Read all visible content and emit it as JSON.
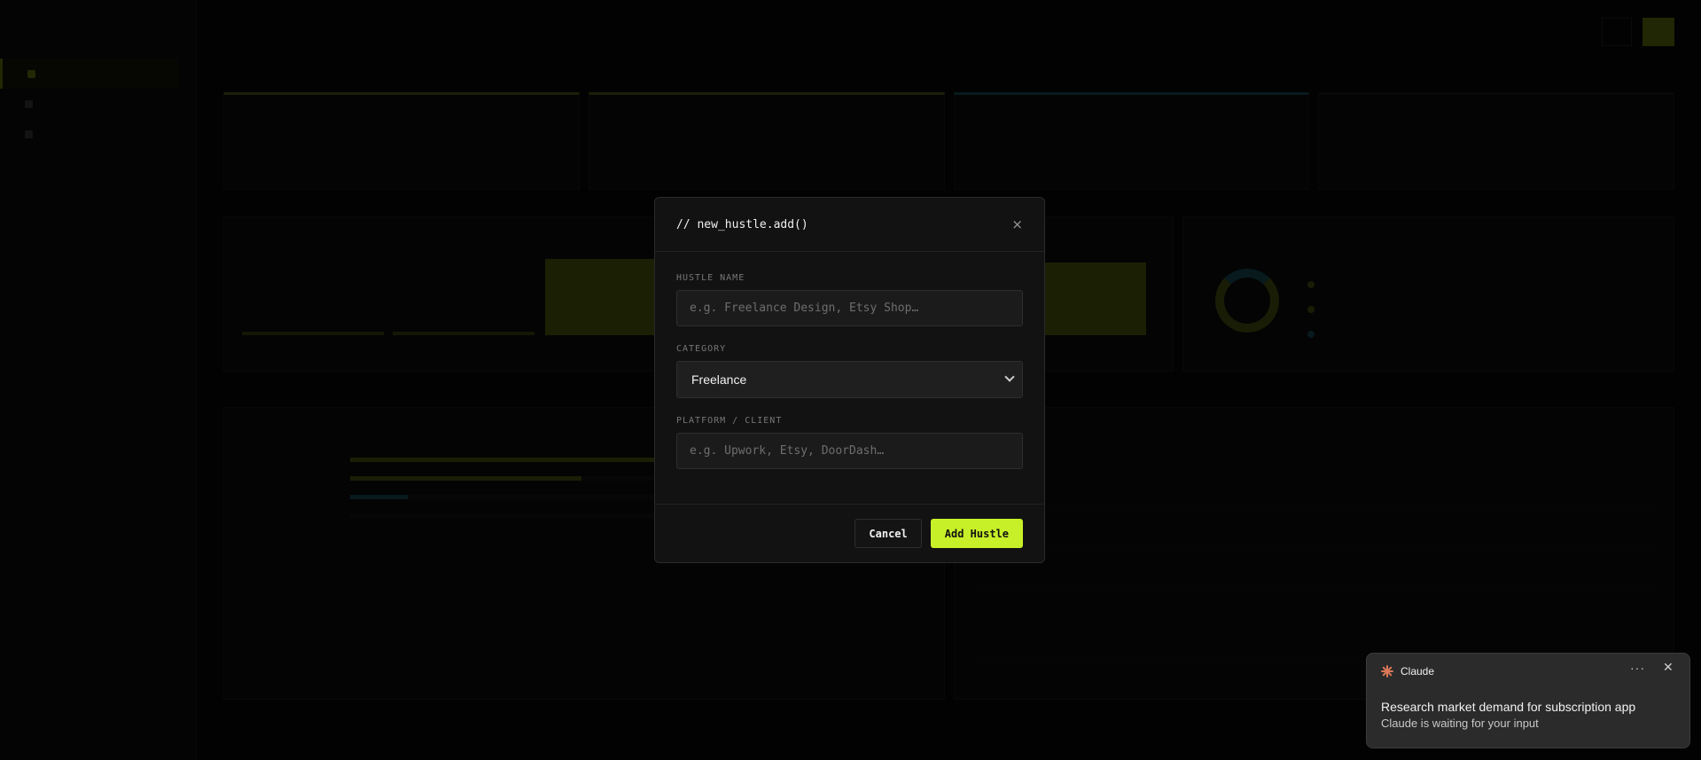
{
  "modal": {
    "title": "// new_hustle.add()",
    "close_glyph": "×",
    "hustle_name_label": "HUSTLE NAME",
    "hustle_name_placeholder": "e.g. Freelance Design, Etsy Shop…",
    "category_label": "CATEGORY",
    "category_value": "Freelance",
    "platform_label": "PLATFORM / CLIENT",
    "platform_placeholder": "e.g. Upwork, Etsy, DoorDash…",
    "cancel_label": "Cancel",
    "add_label": "Add Hustle"
  },
  "toast": {
    "app_name": "Claude",
    "more_glyph": "···",
    "close_glyph": "✕",
    "title": "Research market demand for subscription app",
    "subtitle": "Claude is waiting for your input"
  },
  "colors": {
    "accent": "#c8f028",
    "modal_bg": "#121212",
    "toast_bg": "#2b2b2b",
    "claude_brand": "#d97757"
  },
  "icons": [
    "close-icon",
    "chevron-down-icon",
    "claude-icon",
    "more-icon"
  ]
}
